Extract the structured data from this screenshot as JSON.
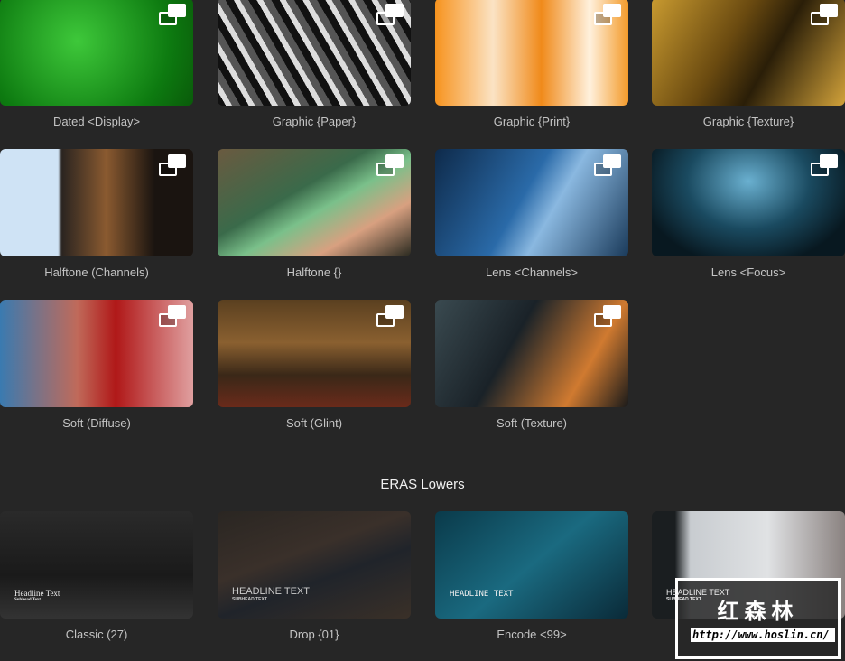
{
  "tiles": [
    {
      "label": "Dated <Display>"
    },
    {
      "label": "Graphic {Paper}"
    },
    {
      "label": "Graphic {Print}"
    },
    {
      "label": "Graphic {Texture}"
    },
    {
      "label": "Halftone (Channels)"
    },
    {
      "label": "Halftone {}"
    },
    {
      "label": "Lens <Channels>"
    },
    {
      "label": "Lens <Focus>"
    },
    {
      "label": "Soft (Diffuse)"
    },
    {
      "label": "Soft (Glint)"
    },
    {
      "label": "Soft (Texture)"
    }
  ],
  "section_title": "ERAS Lowers",
  "lowers": [
    {
      "label": "Classic (27)",
      "headline": "Headline Text",
      "sub": "Subhead Text"
    },
    {
      "label": "Drop {01}",
      "headline": "HEADLINE TEXT",
      "sub": "SUBHEAD TEXT"
    },
    {
      "label": "Encode <99>",
      "headline": "HEADLINE TEXT",
      "sub": ""
    },
    {
      "label": "",
      "headline": "HEADLINE TEXT",
      "sub": "SUBHEAD TEXT"
    }
  ],
  "watermark": {
    "name": "红森林",
    "url": "http://www.hoslin.cn/"
  }
}
